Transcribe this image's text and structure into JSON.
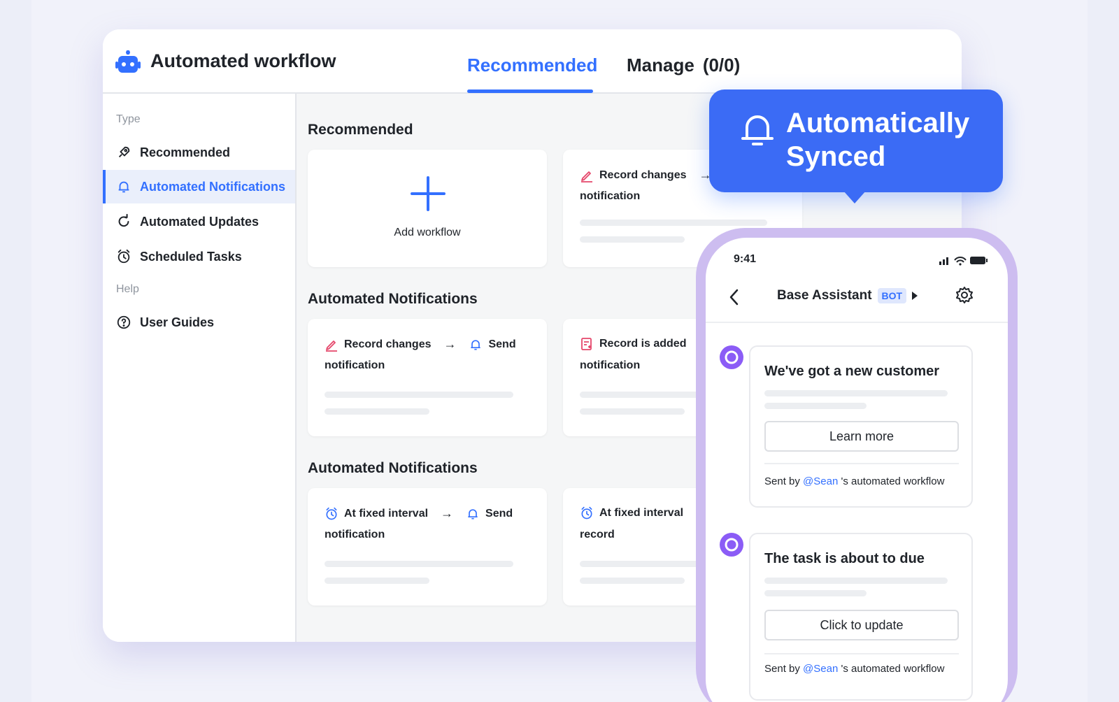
{
  "app": {
    "title": "Automated workflow",
    "tabs": [
      {
        "label": "Recommended",
        "active": true
      },
      {
        "label": "Manage",
        "count": "(0/0)"
      }
    ]
  },
  "sidebar": {
    "type_label": "Type",
    "help_label": "Help",
    "items": [
      {
        "label": "Recommended",
        "icon": "rocket-icon"
      },
      {
        "label": "Automated Notifications",
        "icon": "bell-icon",
        "active": true
      },
      {
        "label": "Automated Updates",
        "icon": "refresh-icon"
      },
      {
        "label": "Scheduled Tasks",
        "icon": "alarm-clock-icon"
      }
    ],
    "help_items": [
      {
        "label": "User Guides",
        "icon": "question-circle-icon"
      }
    ]
  },
  "content": {
    "sections": [
      {
        "title": "Recommended",
        "cards": [
          {
            "add_label": "Add workflow"
          },
          {
            "line1": "Record changes",
            "arrow": "→",
            "line2": "notification"
          }
        ]
      },
      {
        "title": "Automated Notifications",
        "cards": [
          {
            "line1": "Record changes",
            "arrow": "→",
            "action": "Send",
            "line2": "notification"
          },
          {
            "line1": "Record is added",
            "line2": "notification"
          }
        ]
      },
      {
        "title": "Automated Notifications",
        "cards": [
          {
            "line1": "At fixed interval",
            "arrow": "→",
            "action": "Send",
            "line2": "notification"
          },
          {
            "line1": "At fixed interval",
            "line2": "record"
          }
        ]
      }
    ]
  },
  "callout": {
    "line1": "Automatically",
    "line2": "Synced"
  },
  "phone": {
    "time": "9:41",
    "title": "Base Assistant",
    "badge": "BOT",
    "messages": [
      {
        "title": "We've got a new customer",
        "button": "Learn more",
        "footer_prefix": "Sent by",
        "mention": "@Sean",
        "footer_suffix": "'s automated workflow"
      },
      {
        "title": "The task is about to due",
        "button": "Click to update",
        "footer_prefix": "Sent by",
        "mention": "@Sean",
        "footer_suffix": "'s automated workflow"
      }
    ]
  },
  "colors": {
    "accent": "#3370ff",
    "callout": "#3b6bf5",
    "phone_frame": "#cdbdf0",
    "bot_avatar": "#8b5cf6"
  }
}
